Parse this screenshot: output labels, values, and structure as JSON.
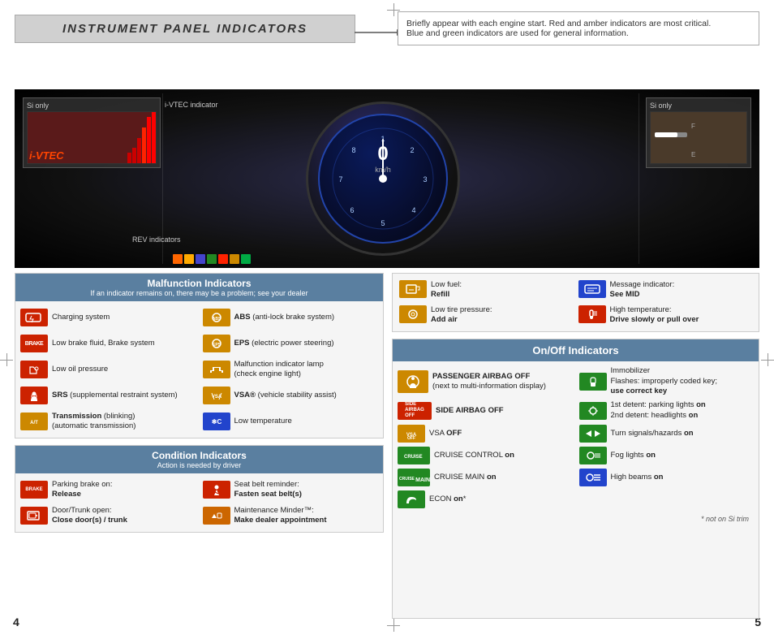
{
  "page": {
    "left_page_number": "4",
    "right_page_number": "5"
  },
  "title": {
    "text": "INSTRUMENT PANEL INDICATORS"
  },
  "info_box": {
    "line1": "Briefly appear with each engine start. Red and amber indicators are most critical.",
    "line2": "Blue and green indicators are used for general information."
  },
  "dashboard": {
    "si_only_left": "Si only",
    "ivtec_indicator_label": "i-VTEC indicator",
    "rev_indicators_label": "REV indicators",
    "si_only_right": "Si only",
    "ivtec_text": "i-VTEC",
    "speed_value": "0",
    "speed_unit": "km/h"
  },
  "malfunction": {
    "header": "Malfunction Indicators",
    "subheader": "If an indicator remains on, there may be a problem; see your dealer",
    "items_left": [
      {
        "label": "Charging system",
        "icon_color": "red",
        "icon_text": "⚡"
      },
      {
        "label": "Low brake fluid, Brake system",
        "icon_color": "brake",
        "icon_text": "BRAKE"
      },
      {
        "label": "Low oil pressure",
        "icon_color": "red",
        "icon_text": "🛢"
      },
      {
        "label": "SRS (supplemental restraint system)",
        "icon_color": "red",
        "icon_text": "👤"
      },
      {
        "label": "Transmission (blinking)\n(automatic transmission)",
        "icon_color": "amber",
        "icon_text": "A/T"
      }
    ],
    "items_right": [
      {
        "label": "ABS (anti-lock brake system)",
        "icon_color": "amber",
        "icon_text": "ABS"
      },
      {
        "label": "EPS (electric power steering)",
        "icon_color": "amber",
        "icon_text": "EPS"
      },
      {
        "label": "Malfunction indicator lamp\n(check engine light)",
        "icon_color": "amber",
        "icon_text": "🔧"
      },
      {
        "label": "VSA® (vehicle stability assist)",
        "icon_color": "amber",
        "icon_text": "VSA"
      },
      {
        "label": "Low temperature",
        "icon_color": "blue",
        "icon_text": "❄C"
      }
    ]
  },
  "condition": {
    "header": "Condition Indicators",
    "subheader": "Action is needed by driver",
    "items_left": [
      {
        "label": "Parking brake on:\nRelease",
        "icon_color": "brake",
        "icon_text": "BRAKE",
        "bold_part": "Release"
      },
      {
        "label": "Door/Trunk open:\nClose door(s) / trunk",
        "icon_color": "red",
        "icon_text": "🚪",
        "bold_part": "Close door(s) / trunk"
      }
    ],
    "items_right": [
      {
        "label": "Seat belt reminder:\nFasten seat belt(s)",
        "icon_color": "red",
        "icon_text": "🔔",
        "bold_part": "Fasten seat belt(s)"
      },
      {
        "label": "Maintenance Minder™:\nMake dealer appointment",
        "icon_color": "orange",
        "icon_text": "🔧",
        "bold_part": "Make dealer appointment"
      }
    ]
  },
  "fuel_tire": {
    "items": [
      {
        "label": "Low fuel:\nRefill",
        "icon_color": "amber",
        "icon_text": "⛽",
        "bold_part": "Refill"
      },
      {
        "label": "Message indicator:\nSee MID",
        "icon_color": "blue",
        "icon_text": "💬",
        "bold_part": "See MID"
      },
      {
        "label": "Low tire pressure:\nAdd air",
        "icon_color": "amber",
        "icon_text": "🔘",
        "bold_part": "Add air"
      },
      {
        "label": "High temperature:\nDrive slowly or pull over",
        "icon_color": "red",
        "icon_text": "🌡",
        "bold_part": "Drive slowly or pull over"
      }
    ]
  },
  "onoff": {
    "header": "On/Off Indicators",
    "footnote": "* not on Si trim",
    "items_left": [
      {
        "label": "PASSENGER AIRBAG OFF\n(next to multi-information display)",
        "icon_color": "amber",
        "icon_text": "👤",
        "bold_part": "PASSENGER AIRBAG OFF"
      },
      {
        "label": "SIDE AIRBAG OFF",
        "icon_color": "red",
        "icon_text": "SA",
        "bold_part": "SIDE AIRBAG OFF"
      },
      {
        "label": "VSA OFF",
        "icon_color": "amber",
        "icon_text": "VSA",
        "bold_part": "VSA OFF"
      },
      {
        "label": "CRUISE CONTROL on",
        "icon_color": "green",
        "icon_text": "CC",
        "bold_part": "CRUISE CONTROL on"
      },
      {
        "label": "CRUISE MAIN on",
        "icon_color": "green",
        "icon_text": "CM",
        "bold_part": "CRUISE MAIN on"
      },
      {
        "label": "ECON on*",
        "icon_color": "green",
        "icon_text": "🌿",
        "bold_part": "ECON on*"
      }
    ],
    "items_right": [
      {
        "label": "Immobilizer\nFlashes: improperly coded key;\nuse correct key",
        "icon_color": "green",
        "icon_text": "🔑",
        "bold_part": "use correct key"
      },
      {
        "label": "1st detent: parking lights on\n2nd detent: headlights on",
        "icon_color": "green",
        "icon_text": "💡",
        "bold_part": ""
      },
      {
        "label": "Turn signals/hazards on",
        "icon_color": "green",
        "icon_text": "↕",
        "bold_part": "Turn signals/hazards on"
      },
      {
        "label": "Fog lights on",
        "icon_color": "green",
        "icon_text": "🌫",
        "bold_part": "Fog lights on"
      },
      {
        "label": "High beams on",
        "icon_color": "blue",
        "icon_text": "◀◀",
        "bold_part": "High beams on"
      }
    ]
  }
}
